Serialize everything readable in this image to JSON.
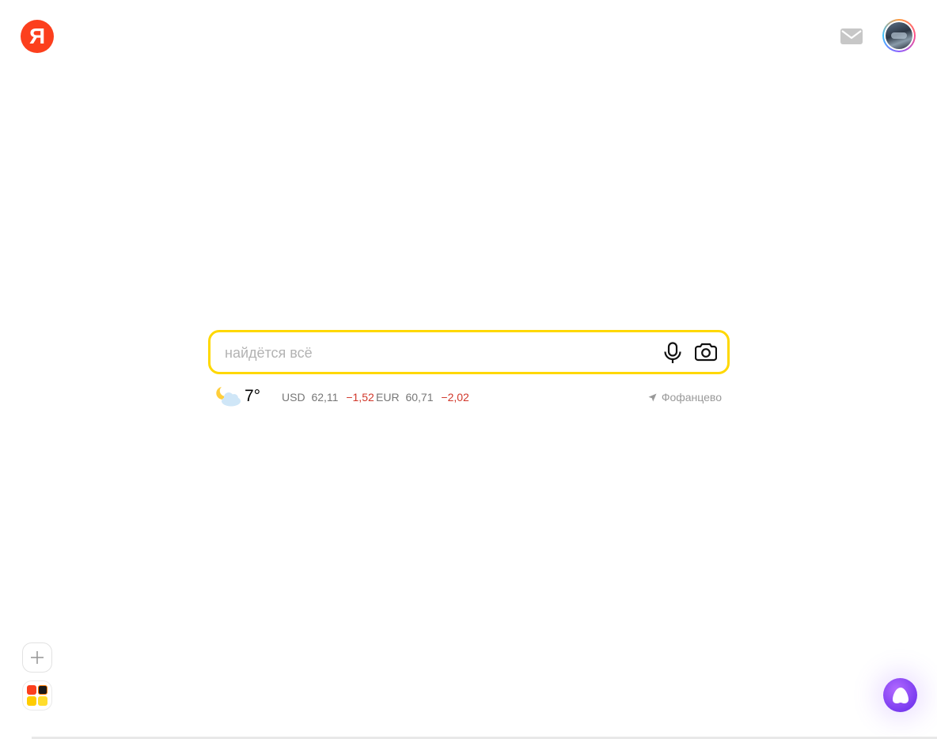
{
  "header": {
    "logo_letter": "Я",
    "mail_icon": "mail-icon",
    "avatar_icon": "user-avatar"
  },
  "search": {
    "placeholder": "найдётся всё",
    "mic_icon": "microphone-icon",
    "camera_icon": "camera-search-icon"
  },
  "weather": {
    "icon": "moon-cloud-icon",
    "temperature": "7°"
  },
  "rates": [
    {
      "currency": "USD",
      "value": "62,11",
      "change": "−1,52"
    },
    {
      "currency": "EUR",
      "value": "60,71",
      "change": "−2,02"
    }
  ],
  "location": {
    "icon": "location-arrow-icon",
    "name": "Фофанцево"
  },
  "bottom_left": {
    "add_icon": "plus-icon",
    "apps_icon": "services-grid-icon"
  },
  "alice": {
    "icon": "alice-icon",
    "color": "#7a3cf0"
  },
  "colors": {
    "brand_red": "#fc3f1d",
    "search_border": "#ffd800",
    "negative_change": "#d1372a"
  }
}
